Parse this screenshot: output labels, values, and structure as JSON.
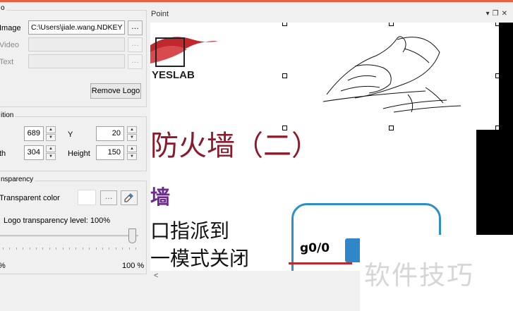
{
  "logo_group": {
    "title": "o",
    "image_label": "Image",
    "image_path": "C:\\Users\\jiale.wang.NDKEY",
    "video_label": "Video",
    "text_label": "Text",
    "browse": "…",
    "remove_logo": "Remove Logo"
  },
  "position_group": {
    "title": "ition",
    "x_value": "689",
    "y_label": "Y",
    "y_value": "20",
    "width_label": "th",
    "width_value": "304",
    "height_label": "Height",
    "height_value": "150"
  },
  "transparency_group": {
    "title": "nsparency",
    "transparent_color_label": "Transparent color",
    "color_value": "#ffffff",
    "level_label": "Logo transparency level: 100%",
    "level_fraction": 1.0,
    "min_label": "%",
    "max_label": "100 %"
  },
  "preview": {
    "title": "Point",
    "logo_text": "YESLAB",
    "slide_title": "防火墙（二）",
    "subtitle": "墙",
    "line1": "口指派到",
    "line2": "一模式关闭",
    "port_label": "g0/0",
    "watermark": "软件技巧",
    "scroll_left": "<"
  },
  "colors": {
    "accent": "#e8603c",
    "slide_title": "#8b1a2b",
    "subtitle": "#6a2c8c",
    "net_box": "#2d8fc4"
  }
}
